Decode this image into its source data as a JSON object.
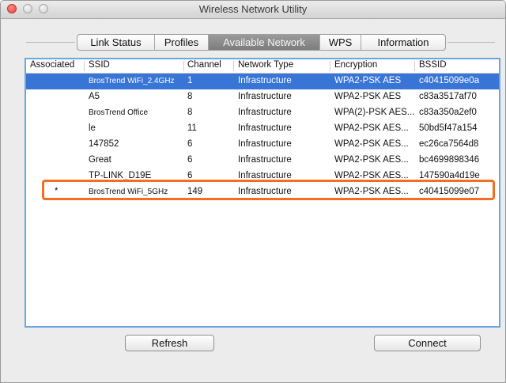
{
  "window": {
    "title": "Wireless Network Utility"
  },
  "tabs": [
    {
      "label": "Link Status",
      "active": false
    },
    {
      "label": "Profiles",
      "active": false
    },
    {
      "label": "Available Network",
      "active": true
    },
    {
      "label": "WPS",
      "active": false
    },
    {
      "label": "Information",
      "active": false
    }
  ],
  "table": {
    "columns": [
      "Associated",
      "SSID",
      "Channel",
      "Network Type",
      "Encryption",
      "BSSID"
    ],
    "rows": [
      {
        "associated": "",
        "ssid": "BrosTrend WiFi_2.4GHz",
        "channel": "1",
        "type": "Infrastructure",
        "encryption": "WPA2-PSK AES",
        "bssid": "c40415099e0a"
      },
      {
        "associated": "",
        "ssid": "A5",
        "channel": "8",
        "type": "Infrastructure",
        "encryption": "WPA2-PSK AES",
        "bssid": "c83a3517af70"
      },
      {
        "associated": "",
        "ssid": "BrosTrend Office",
        "channel": "8",
        "type": "Infrastructure",
        "encryption": "WPA(2)-PSK AES...",
        "bssid": "c83a350a2ef0"
      },
      {
        "associated": "",
        "ssid": "le",
        "channel": "11",
        "type": "Infrastructure",
        "encryption": "WPA2-PSK AES...",
        "bssid": "50bd5f47a154"
      },
      {
        "associated": "",
        "ssid": "147852",
        "channel": "6",
        "type": "Infrastructure",
        "encryption": "WPA2-PSK AES...",
        "bssid": "ec26ca7564d8"
      },
      {
        "associated": "",
        "ssid": "Great",
        "channel": "6",
        "type": "Infrastructure",
        "encryption": "WPA2-PSK AES...",
        "bssid": "bc4699898346"
      },
      {
        "associated": "",
        "ssid": "TP-LINK_D19E",
        "channel": "6",
        "type": "Infrastructure",
        "encryption": "WPA2-PSK AES...",
        "bssid": "147590a4d19e"
      },
      {
        "associated": "*",
        "ssid": "BrosTrend WiFi_5GHz",
        "channel": "149",
        "type": "Infrastructure",
        "encryption": "WPA2-PSK AES...",
        "bssid": "c40415099e07"
      }
    ]
  },
  "buttons": {
    "refresh": "Refresh",
    "connect": "Connect"
  },
  "colors": {
    "selection": "#3875d7",
    "highlight": "#f26e22",
    "panel_border": "#6aa6df"
  }
}
